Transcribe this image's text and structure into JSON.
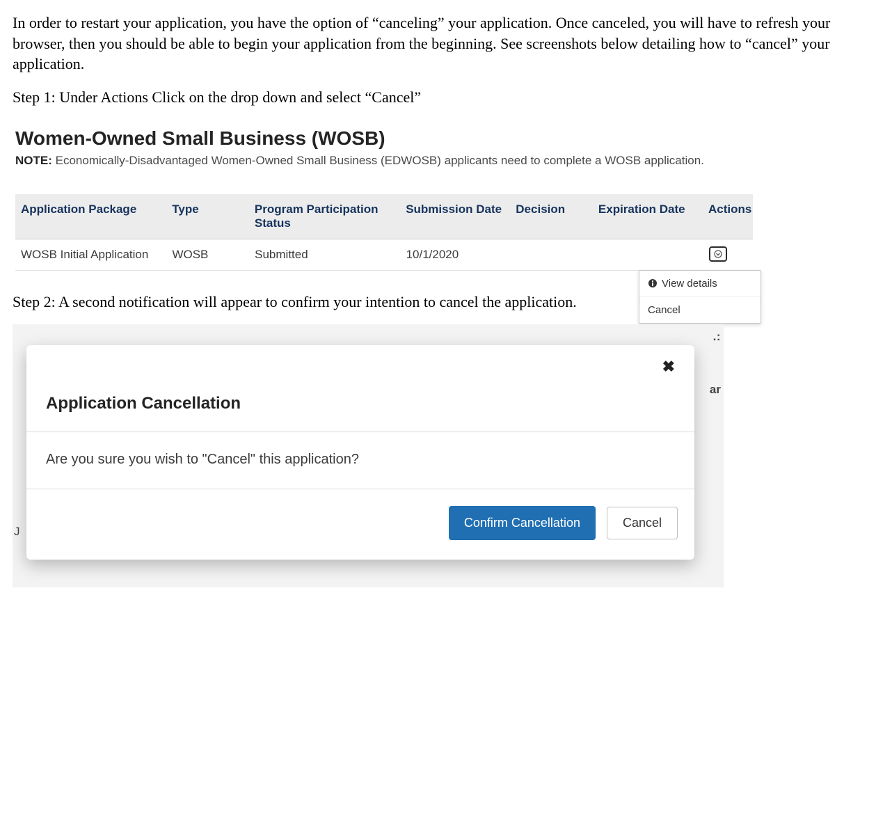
{
  "intro": "In order to restart your application, you have the option of “canceling” your application. Once canceled, you will have to refresh your browser, then you should be able to begin your application from the beginning. See screenshots below detailing how to “cancel” your application.",
  "step1": "Step 1: Under Actions Click on the drop down and select “Cancel”",
  "step2": "Step 2: A second notification will appear to confirm your intention to cancel the application.",
  "shot1": {
    "heading": "Women-Owned Small Business (WOSB)",
    "note_label": "NOTE:",
    "note_text": "Economically-Disadvantaged Women-Owned Small Business (EDWOSB) applicants need to complete a WOSB application.",
    "columns": {
      "pkg": "Application Package",
      "type": "Type",
      "pps": "Program Participation Status",
      "sub": "Submission Date",
      "dec": "Decision",
      "exp": "Expiration Date",
      "act": "Actions"
    },
    "row": {
      "pkg": "WOSB Initial Application",
      "type": "WOSB",
      "pps": "Submitted",
      "sub": "10/1/2020",
      "dec": "",
      "exp": ""
    },
    "dropdown": {
      "view_details": "View details",
      "cancel": "Cancel"
    }
  },
  "shot2": {
    "modal_title": "Application Cancellation",
    "modal_body": "Are you sure you wish to \"Cancel\" this application?",
    "confirm_btn": "Confirm Cancellation",
    "cancel_btn": "Cancel",
    "cut_tr1": ".:",
    "cut_tr2": "ar",
    "cut_left": "J"
  }
}
